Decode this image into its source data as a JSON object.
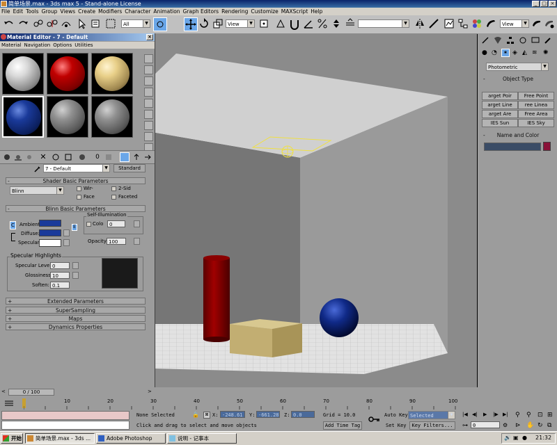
{
  "window": {
    "title": "简单场景.max - 3ds max 5 - Stand-alone License"
  },
  "menu": [
    "File",
    "Edit",
    "Tools",
    "Group",
    "Views",
    "Create",
    "Modifiers",
    "Character",
    "Animation",
    "Graph Editors",
    "Rendering",
    "Customize",
    "MAXScript",
    "Help"
  ],
  "toolbar": {
    "selection_filter": "All",
    "coord_system": "View",
    "named_selection": "",
    "render_view": "View"
  },
  "material_editor": {
    "title": "Material Editor - 7 - Default",
    "menu": [
      "Material",
      "Navigation",
      "Options",
      "Utilities"
    ],
    "material_name": "7 - Default",
    "material_type": "Standard",
    "rollouts": {
      "shader_basic": "Shader Basic Parameters",
      "blinn_basic": "Blinn Basic Parameters",
      "specular_highlights": "Specular Highlights",
      "extended": "Extended Parameters",
      "supersampling": "SuperSampling",
      "maps": "Maps",
      "dynamics": "Dynamics Properties"
    },
    "shader": {
      "type": "Blinn",
      "wire": "Wir-",
      "two_sided": "2-Sid",
      "face_map": "Face",
      "faceted": "Faceted"
    },
    "blinn": {
      "ambient_label": "Ambient:",
      "diffuse_label": "Diffuse:",
      "specular_label": "Specular:",
      "lock_label": "C",
      "map_label": "E",
      "self_illum_label": "Self-Illumination",
      "color_label": "Colo",
      "color_value": "0",
      "opacity_label": "Opacity:",
      "opacity_value": "100"
    },
    "specular": {
      "level_label": "Specular Level:",
      "level_value": "0",
      "gloss_label": "Glossiness:",
      "gloss_value": "10",
      "soften_label": "Soften:",
      "soften_value": "0.1"
    }
  },
  "command_panel": {
    "light_category": "Photometric",
    "object_type_label": "Object Type",
    "buttons": [
      "arget Poir",
      "Free Point",
      "arget Line",
      "ree Linea",
      "arget Are",
      "Free Area",
      "IES Sun",
      "IES Sky"
    ],
    "name_color_label": "Name and Color",
    "object_name": ""
  },
  "timeline": {
    "frame_display": "0 / 100",
    "ticks": [
      "10",
      "20",
      "30",
      "40",
      "50",
      "60",
      "70",
      "80",
      "90",
      "100"
    ]
  },
  "status": {
    "selection": "None Selected",
    "x_label": "X:",
    "x_value": "-248.61",
    "y_label": "Y:",
    "y_value": "-661.28",
    "z_label": "Z:",
    "z_value": "0.0",
    "grid": "Grid = 10.0",
    "prompt": "Click and drag to select and move objects",
    "add_time_tag": "Add Time Tag",
    "auto_key": "Auto Key",
    "set_key": "Set Key",
    "key_filter": "Selected",
    "key_filters": "Key Filters...",
    "current_frame": "0"
  },
  "taskbar": {
    "start": "开始",
    "tasks": [
      "简单场景.max - 3ds ...",
      "Adobe Photoshop",
      "说明 - 记事本"
    ],
    "clock": "21:32"
  },
  "colors": {
    "title_bar": "#0a246a",
    "ambient": "#1a3a9a",
    "diffuse": "#1a3a9a",
    "specular": "#ffffff",
    "name_color": "#8a1238",
    "move_tool_active": "#6aa6e8"
  }
}
